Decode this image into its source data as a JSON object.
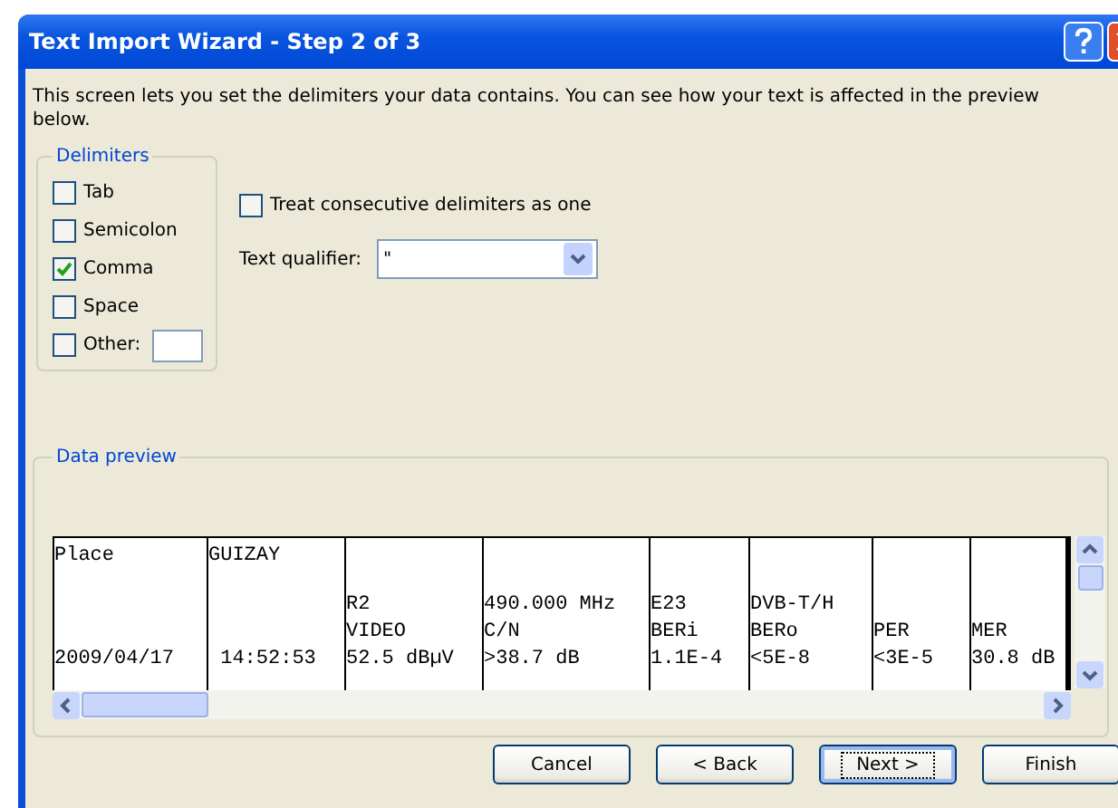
{
  "window": {
    "title": "Text Import Wizard - Step 2 of 3"
  },
  "description": "This screen lets you set the delimiters your data contains.  You can see how your text is affected in the preview below.",
  "delimiters": {
    "title": "Delimiters",
    "items": [
      {
        "label": "Tab",
        "checked": false
      },
      {
        "label": "Semicolon",
        "checked": false
      },
      {
        "label": "Comma",
        "checked": true
      },
      {
        "label": "Space",
        "checked": false
      },
      {
        "label": "Other:",
        "checked": false
      }
    ]
  },
  "consecutive": {
    "label": "Treat consecutive delimiters as one",
    "checked": false
  },
  "qualifier": {
    "label": "Text qualifier:",
    "value": "\""
  },
  "preview": {
    "title": "Data preview",
    "rows": [
      {
        "cells": [
          [
            "Place"
          ],
          [
            "GUIZAY"
          ],
          [],
          [],
          [],
          [],
          [],
          []
        ]
      },
      {
        "cells": [
          [
            "2009/04/17"
          ],
          [
            " 14:52:53"
          ],
          [
            "R2",
            "VIDEO",
            "52.5 dBµV"
          ],
          [
            "490.000 MHz",
            "C/N",
            ">38.7 dB"
          ],
          [
            "E23",
            "BERi",
            "1.1E-4"
          ],
          [
            "DVB-T/H",
            "BERo",
            "<5E-8"
          ],
          [
            "PER",
            "<3E-5"
          ],
          [
            "MER",
            "30.8 dB"
          ]
        ]
      }
    ]
  },
  "buttons": [
    {
      "label": "Cancel",
      "default": false
    },
    {
      "label": "< Back",
      "default": false
    },
    {
      "label": "Next >",
      "default": true
    },
    {
      "label": "Finish",
      "default": false
    }
  ]
}
